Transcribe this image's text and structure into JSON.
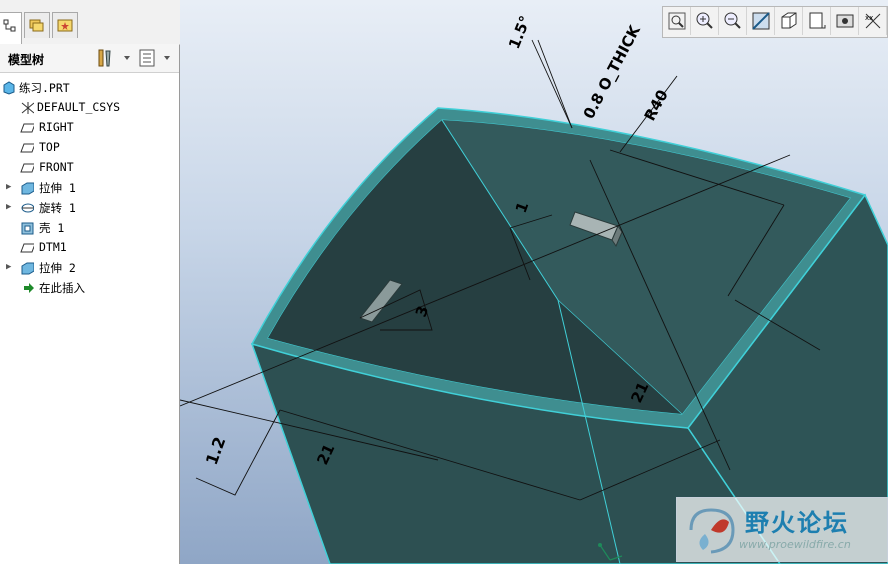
{
  "model_tree": {
    "title": "模型树",
    "items": [
      {
        "label": "练习.PRT",
        "icon": "part-icon",
        "expandable": false
      },
      {
        "label": "DEFAULT_CSYS",
        "icon": "csys-icon",
        "expandable": false
      },
      {
        "label": "RIGHT",
        "icon": "datum-plane-icon",
        "expandable": false
      },
      {
        "label": "TOP",
        "icon": "datum-plane-icon",
        "expandable": false
      },
      {
        "label": "FRONT",
        "icon": "datum-plane-icon",
        "expandable": false
      },
      {
        "label": "拉伸 1",
        "icon": "extrude-icon",
        "expandable": true
      },
      {
        "label": "旋转 1",
        "icon": "revolve-icon",
        "expandable": true
      },
      {
        "label": "壳 1",
        "icon": "shell-icon",
        "expandable": false
      },
      {
        "label": "DTM1",
        "icon": "datum-plane-icon",
        "expandable": false
      },
      {
        "label": "拉伸 2",
        "icon": "extrude-icon",
        "expandable": true
      },
      {
        "label": "在此插入",
        "icon": "insert-here-icon",
        "expandable": false
      }
    ]
  },
  "viewport": {
    "dimensions": {
      "angle": "1.5°",
      "thick": "0.8 O_THICK",
      "radius": "R40",
      "d_one": "1",
      "d_three": "3",
      "d_onetwo": "1.2",
      "d_21_left": "21",
      "d_21_right": "21"
    },
    "toolbar": [
      "refit-icon",
      "zoom-in-icon",
      "zoom-out-icon",
      "repaint-icon",
      "orientation-icon",
      "saved-views-icon",
      "display-style-icon",
      "datum-display-icon"
    ],
    "colors": {
      "model_face": "#2f5a5c",
      "model_edge": "#40d0d8",
      "background_top": "#e8eef6",
      "background_bottom": "#8fa6c6"
    }
  },
  "watermark": {
    "title": "野火论坛",
    "url": "www.proewildfire.cn"
  }
}
